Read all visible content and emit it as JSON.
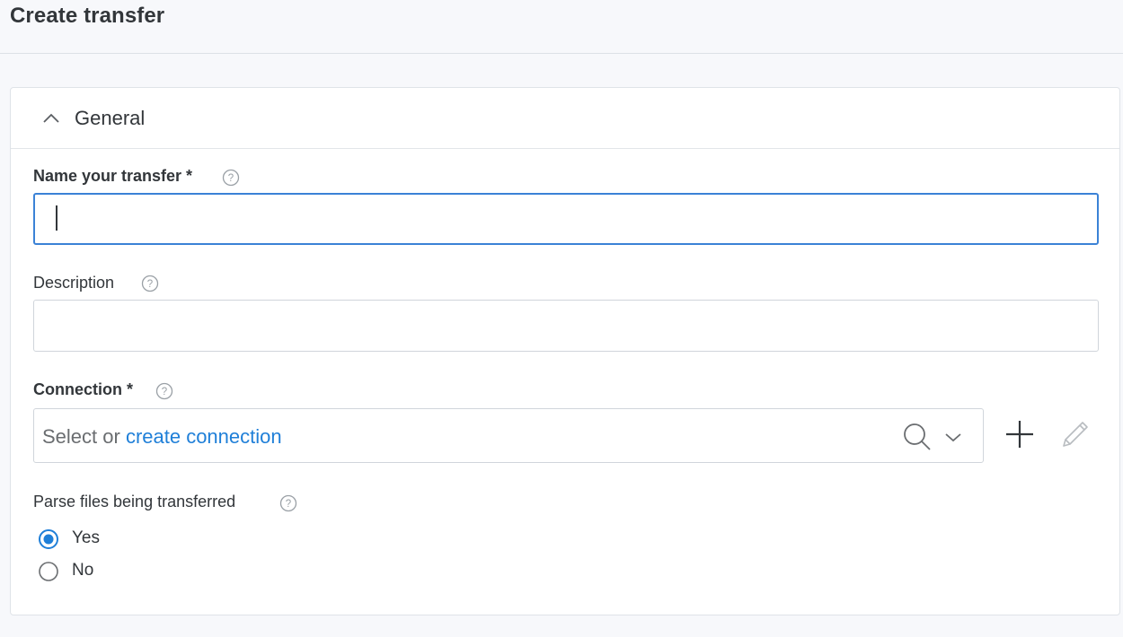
{
  "page": {
    "title": "Create transfer"
  },
  "section": {
    "title": "General"
  },
  "fields": {
    "name": {
      "label": "Name your transfer *",
      "value": ""
    },
    "description": {
      "label": "Description",
      "value": ""
    },
    "connection": {
      "label": "Connection *",
      "placeholder_prefix": "Select or ",
      "placeholder_link": "create connection"
    },
    "parse": {
      "label": "Parse files being transferred",
      "options": [
        {
          "label": "Yes",
          "selected": true
        },
        {
          "label": "No",
          "selected": false
        }
      ]
    }
  },
  "colors": {
    "accent": "#1f7fd8",
    "focus_border": "#3b82d6",
    "text": "#32363a",
    "muted": "#9aa0a6"
  },
  "icons": {
    "collapse": "chevron-up-icon",
    "help": "help-icon",
    "search": "search-icon",
    "dropdown": "chevron-down-icon",
    "add": "plus-icon",
    "edit": "pencil-icon"
  }
}
